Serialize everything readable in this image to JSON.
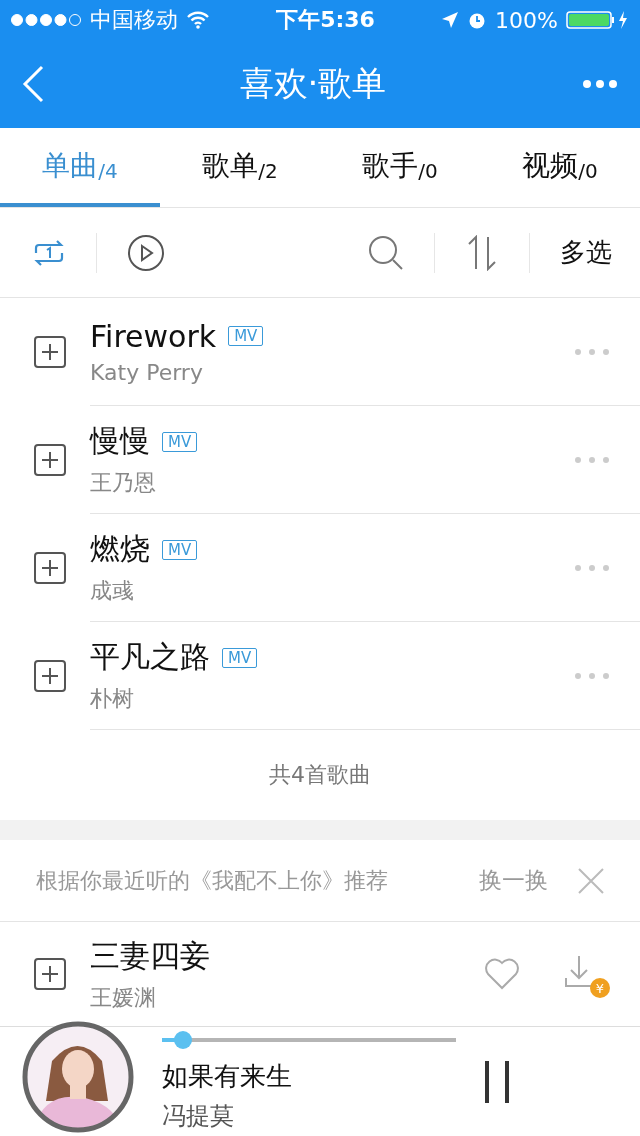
{
  "status_bar": {
    "carrier": "中国移动",
    "time": "下午5:36",
    "battery": "100%"
  },
  "nav": {
    "title": "喜欢·歌单"
  },
  "tabs": [
    {
      "label": "单曲",
      "count": "/4",
      "selected": true
    },
    {
      "label": "歌单",
      "count": "/2",
      "selected": false
    },
    {
      "label": "歌手",
      "count": "/0",
      "selected": false
    },
    {
      "label": "视频",
      "count": "/0",
      "selected": false
    }
  ],
  "toolbar": {
    "multi_select": "多选"
  },
  "songs": [
    {
      "title": "Firework",
      "artist": "Katy Perry",
      "mv": "MV"
    },
    {
      "title": "慢慢",
      "artist": "王乃恩",
      "mv": "MV"
    },
    {
      "title": "燃烧",
      "artist": "成彧",
      "mv": "MV"
    },
    {
      "title": "平凡之路",
      "artist": "朴树",
      "mv": "MV"
    }
  ],
  "song_count": "共4首歌曲",
  "recommend": {
    "text": "根据你最近听的《我配不上你》推荐",
    "refresh": "换一换",
    "songs": [
      {
        "title": "三妻四妾",
        "artist": "王媛渊",
        "badge": "¥"
      }
    ]
  },
  "player": {
    "title": "如果有来生",
    "artist": "冯提莫",
    "level": 0.07,
    "playing": true
  }
}
